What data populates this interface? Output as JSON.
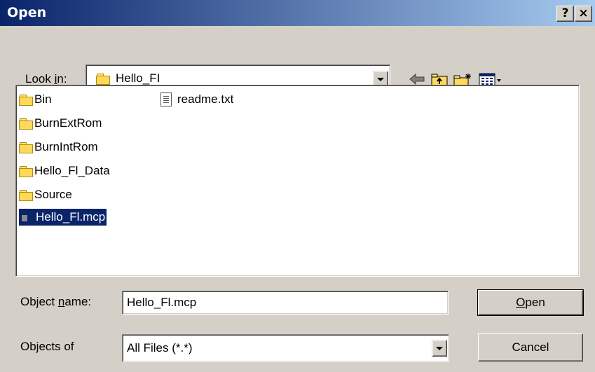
{
  "window": {
    "title": "Open",
    "help_label": "?",
    "close_label": "×"
  },
  "lookin": {
    "label_pre": "Look ",
    "label_accel": "i",
    "label_post": "n:",
    "value": "Hello_FI"
  },
  "toolbar": {
    "back_icon": "back-arrow-icon",
    "up_icon": "up-folder-icon",
    "new_icon": "new-folder-icon",
    "view_icon": "view-menu-icon"
  },
  "files": [
    {
      "name": "Bin",
      "type": "folder"
    },
    {
      "name": "BurnExtRom",
      "type": "folder"
    },
    {
      "name": "BurnIntRom",
      "type": "folder"
    },
    {
      "name": "Hello_Fl_Data",
      "type": "folder"
    },
    {
      "name": "Source",
      "type": "folder"
    },
    {
      "name": "Hello_Fl.mcp",
      "type": "project",
      "selected": true
    },
    {
      "name": "readme.txt",
      "type": "text"
    }
  ],
  "object_name": {
    "label_pre": "Object ",
    "label_accel": "n",
    "label_post": "ame:",
    "value": "Hello_Fl.mcp"
  },
  "objects_of": {
    "label": "Objects of",
    "value": "All Files (*.*)"
  },
  "buttons": {
    "open_accel": "O",
    "open_rest": "pen",
    "cancel": "Cancel"
  }
}
